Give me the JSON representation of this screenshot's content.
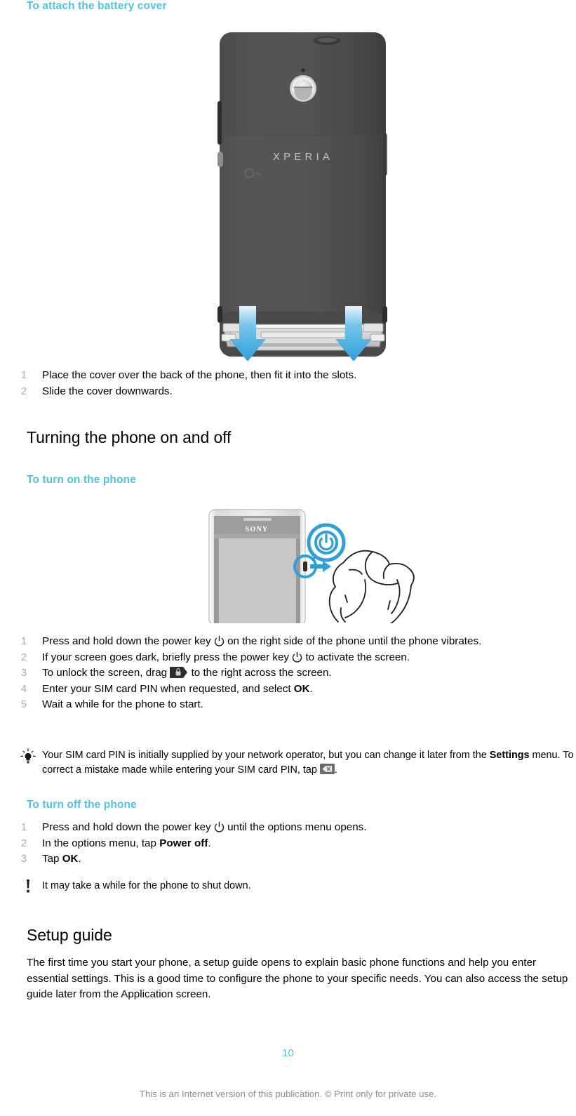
{
  "document": {
    "page_number": "10",
    "footer": "This is an Internet version of this publication. © Print only for private use."
  },
  "colors": {
    "heading_cyan": "#4ec2e0",
    "step_number_gray": "#a9a9a9",
    "body_black": "#000000",
    "footer_gray": "#8d8d8d",
    "arrow_blue": "#2e9fd8",
    "phone_body_dark": "#4a4848",
    "phone_body_light": "#c9c9c9"
  },
  "sections": [
    {
      "id": "attach-battery-cover",
      "heading": "To attach the battery cover",
      "figure": {
        "name": "phone-back-battery-cover-illustration",
        "logo": "XPERIA",
        "arrows": 2
      },
      "steps": [
        {
          "num": "1",
          "text": "Place the cover over the back of the phone, then fit it into the slots."
        },
        {
          "num": "2",
          "text": "Slide the cover downwards."
        }
      ]
    },
    {
      "id": "turning-on-off",
      "heading": "Turning the phone on and off"
    },
    {
      "id": "turn-on-phone",
      "heading": "To turn on the phone",
      "figure": {
        "name": "phone-front-power-key-illustration",
        "logo": "SONY",
        "callout_icon": "power-icon"
      },
      "steps": [
        {
          "num": "1",
          "parts": [
            {
              "type": "text",
              "value": "Press and hold down the power key "
            },
            {
              "type": "icon",
              "value": "power-icon"
            },
            {
              "type": "text",
              "value": " on the right side of the phone until the phone vibrates."
            }
          ]
        },
        {
          "num": "2",
          "parts": [
            {
              "type": "text",
              "value": "If your screen goes dark, briefly press the power key "
            },
            {
              "type": "icon",
              "value": "power-icon"
            },
            {
              "type": "text",
              "value": " to activate the screen."
            }
          ]
        },
        {
          "num": "3",
          "parts": [
            {
              "type": "text",
              "value": "To unlock the screen, drag "
            },
            {
              "type": "icon",
              "value": "lock-icon"
            },
            {
              "type": "text",
              "value": " to the right across the screen."
            }
          ]
        },
        {
          "num": "4",
          "parts": [
            {
              "type": "text",
              "value": "Enter your SIM card PIN when requested, and select "
            },
            {
              "type": "bold",
              "value": "OK"
            },
            {
              "type": "text",
              "value": "."
            }
          ]
        },
        {
          "num": "5",
          "parts": [
            {
              "type": "text",
              "value": "Wait a while for the phone to start."
            }
          ]
        }
      ],
      "tip": {
        "icon": "lightbulb-icon",
        "parts": [
          {
            "type": "text",
            "value": "Your SIM card PIN is initially supplied by your network operator, but you can change it later from the "
          },
          {
            "type": "bold",
            "value": "Settings"
          },
          {
            "type": "text",
            "value": " menu. To correct a mistake made while entering your SIM card PIN, tap "
          },
          {
            "type": "icon",
            "value": "backspace-icon"
          },
          {
            "type": "text",
            "value": "."
          }
        ]
      }
    },
    {
      "id": "turn-off-phone",
      "heading": "To turn off the phone",
      "steps": [
        {
          "num": "1",
          "parts": [
            {
              "type": "text",
              "value": "Press and hold down the power key "
            },
            {
              "type": "icon",
              "value": "power-icon"
            },
            {
              "type": "text",
              "value": " until the options menu opens."
            }
          ]
        },
        {
          "num": "2",
          "parts": [
            {
              "type": "text",
              "value": "In the options menu, tap "
            },
            {
              "type": "bold",
              "value": "Power off"
            },
            {
              "type": "text",
              "value": "."
            }
          ]
        },
        {
          "num": "3",
          "parts": [
            {
              "type": "text",
              "value": "Tap "
            },
            {
              "type": "bold",
              "value": "OK"
            },
            {
              "type": "text",
              "value": "."
            }
          ]
        }
      ],
      "note": {
        "icon": "exclamation-icon",
        "text": "It may take a while for the phone to shut down."
      }
    },
    {
      "id": "setup-guide",
      "heading": "Setup guide",
      "body": "The first time you start your phone, a setup guide opens to explain basic phone functions and help you enter essential settings. This is a good time to configure the phone to your specific needs. You can also access the setup guide later from the Application screen."
    }
  ]
}
